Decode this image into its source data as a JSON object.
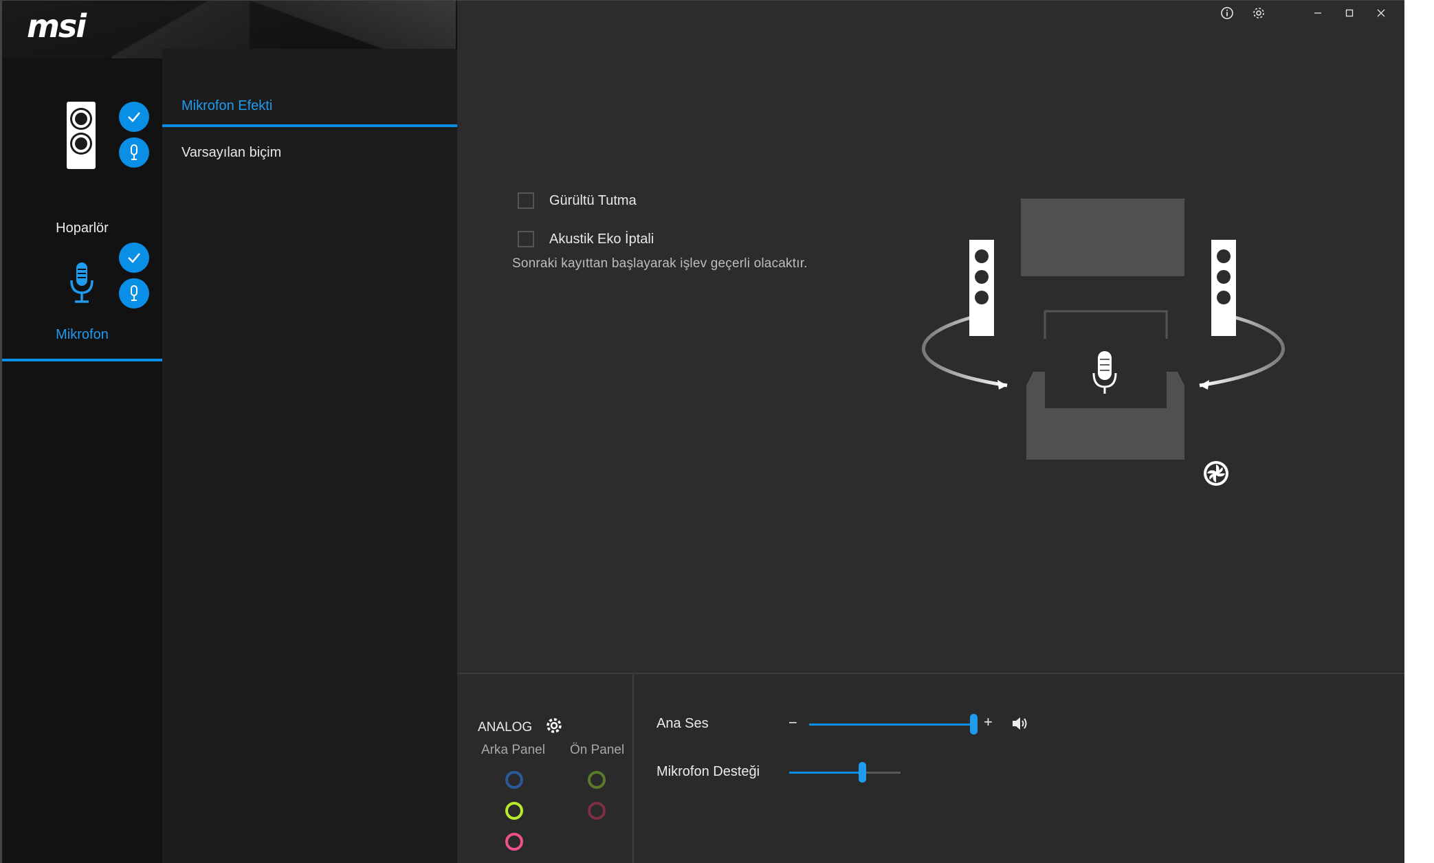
{
  "app": {
    "brand": "msi"
  },
  "devices": [
    {
      "label": "Hoparlör",
      "icon": "speaker-icon",
      "active": false
    },
    {
      "label": "Mikrofon",
      "icon": "microphone-icon",
      "active": true
    }
  ],
  "menu": {
    "items": [
      {
        "label": "Mikrofon Efekti",
        "active": true
      },
      {
        "label": "Varsayılan biçim",
        "active": false
      }
    ]
  },
  "titlebar": {
    "icons": [
      "info-icon",
      "settings-icon",
      "minimize-icon",
      "maximize-icon",
      "close-icon"
    ]
  },
  "effects": {
    "noise_suppression": {
      "label": "Gürültü Tutma",
      "checked": false
    },
    "echo_cancellation": {
      "label": "Akustik Eko İptali",
      "checked": false
    },
    "note": "Sonraki kayıttan başlayarak işlev geçerli olacaktır."
  },
  "analog": {
    "title": "ANALOG",
    "rear_panel_label": "Arka Panel",
    "front_panel_label": "Ön Panel",
    "rear_jacks": [
      "#2a5a9a",
      "#b6ea2c",
      "#f0508c"
    ],
    "front_jacks": [
      "#5a7a28",
      "#7a3040"
    ]
  },
  "volume": {
    "master_label": "Ana Ses",
    "master_level": 1.0,
    "boost_label": "Mikrofon Desteği",
    "boost_level": 0.66,
    "minus": "−",
    "plus": "+"
  },
  "colors": {
    "accent": "#0a8fe6",
    "background": "#2c2c2c"
  }
}
